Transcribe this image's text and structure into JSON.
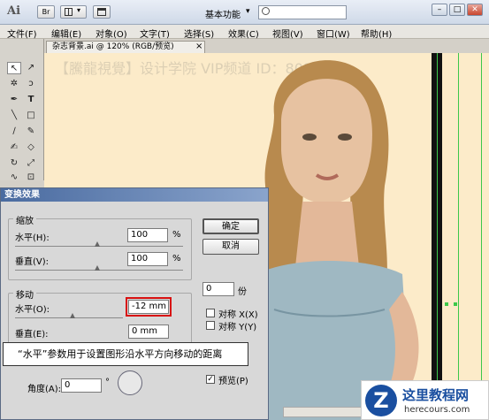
{
  "app": {
    "logo": "Ai",
    "bridge_label": "Br",
    "workspace": "基本功能",
    "window_controls": [
      "–",
      "□",
      "✕"
    ]
  },
  "menu": [
    "文件(F)",
    "编辑(E)",
    "对象(O)",
    "文字(T)",
    "选择(S)",
    "效果(C)",
    "视图(V)",
    "窗口(W)",
    "帮助(H)"
  ],
  "document": {
    "tab_title": "杂志背景.ai @ 120% (RGB/预览)",
    "tab_close": "×",
    "watermark": "【騰龍視覺】设计学院  VIP频道 ID：80101"
  },
  "dialog": {
    "title": "变换效果",
    "scale": {
      "label": "缩放",
      "h_label": "水平(H):",
      "h_value": "100",
      "h_unit": "%",
      "v_label": "垂直(V):",
      "v_value": "100",
      "v_unit": "%"
    },
    "move": {
      "label": "移动",
      "h_label": "水平(O):",
      "h_value": "-12 mm",
      "v_label": "垂直(E):",
      "v_value": "0 mm"
    },
    "rotate": {
      "angle_label": "角度(A):",
      "angle_value": "0",
      "angle_unit": "°"
    },
    "buttons": {
      "ok": "确定",
      "cancel": "取消"
    },
    "copies": {
      "value": "0",
      "unit": "份"
    },
    "options": {
      "reflect_x": "对称 X(X)",
      "reflect_y": "对称 Y(Y)",
      "preview": "预览(P)",
      "preview_checked": true
    }
  },
  "tooltip": "“水平”参数用于设置图形沿水平方向移动的距离",
  "brand": {
    "name": "这里教程网",
    "url": "herecours.com"
  },
  "colors": {
    "highlight": "#d81010",
    "guide": "#3cc84a",
    "canvas": "#fcebc9"
  }
}
